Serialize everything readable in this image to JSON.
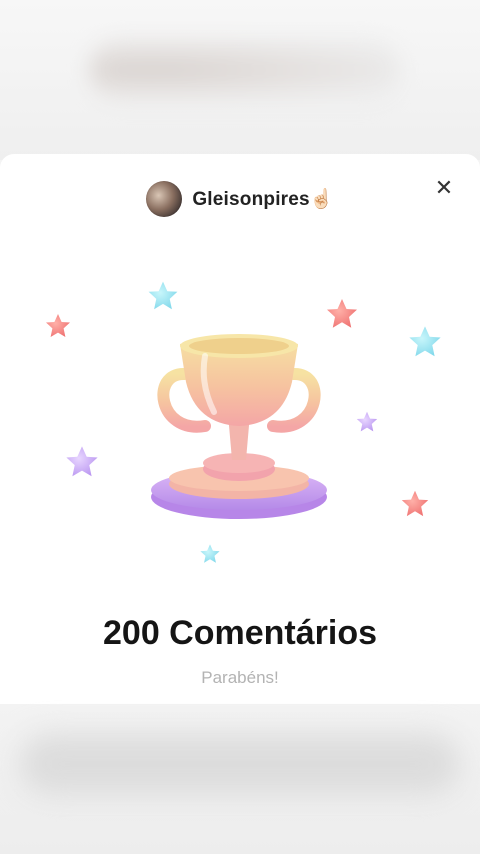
{
  "profile": {
    "username": "Gleisonpires",
    "emoji": "☝🏻"
  },
  "icons": {
    "close": "close-icon",
    "trophy": "trophy-icon",
    "stars": "star-icon"
  },
  "achievement": {
    "title": "200 Comentários",
    "subtitle": "Parabéns!"
  },
  "colors": {
    "title": "#151515",
    "subtitle": "#b3b3b3",
    "star_red": "#f07d7d",
    "star_blue": "#8ee0ee",
    "star_purple": "#c9a6f5",
    "trophy_gold": "#f5d68f",
    "base_purple": "#c9a0f0"
  }
}
